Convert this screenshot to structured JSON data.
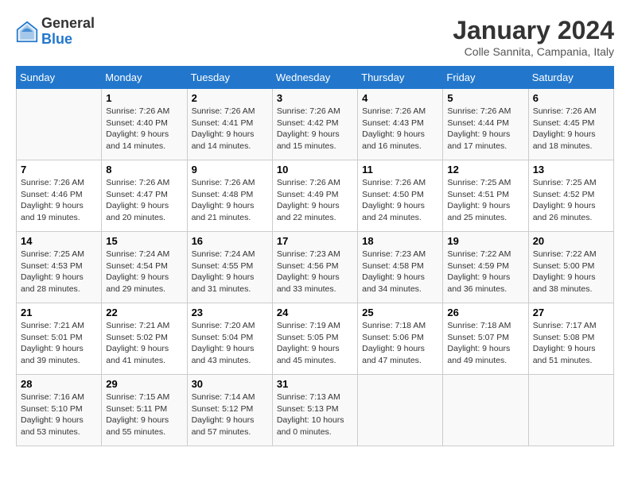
{
  "header": {
    "logo_general": "General",
    "logo_blue": "Blue",
    "title": "January 2024",
    "location": "Colle Sannita, Campania, Italy"
  },
  "days_of_week": [
    "Sunday",
    "Monday",
    "Tuesday",
    "Wednesday",
    "Thursday",
    "Friday",
    "Saturday"
  ],
  "weeks": [
    [
      {
        "num": "",
        "info": ""
      },
      {
        "num": "1",
        "info": "Sunrise: 7:26 AM\nSunset: 4:40 PM\nDaylight: 9 hours\nand 14 minutes."
      },
      {
        "num": "2",
        "info": "Sunrise: 7:26 AM\nSunset: 4:41 PM\nDaylight: 9 hours\nand 14 minutes."
      },
      {
        "num": "3",
        "info": "Sunrise: 7:26 AM\nSunset: 4:42 PM\nDaylight: 9 hours\nand 15 minutes."
      },
      {
        "num": "4",
        "info": "Sunrise: 7:26 AM\nSunset: 4:43 PM\nDaylight: 9 hours\nand 16 minutes."
      },
      {
        "num": "5",
        "info": "Sunrise: 7:26 AM\nSunset: 4:44 PM\nDaylight: 9 hours\nand 17 minutes."
      },
      {
        "num": "6",
        "info": "Sunrise: 7:26 AM\nSunset: 4:45 PM\nDaylight: 9 hours\nand 18 minutes."
      }
    ],
    [
      {
        "num": "7",
        "info": "Sunrise: 7:26 AM\nSunset: 4:46 PM\nDaylight: 9 hours\nand 19 minutes."
      },
      {
        "num": "8",
        "info": "Sunrise: 7:26 AM\nSunset: 4:47 PM\nDaylight: 9 hours\nand 20 minutes."
      },
      {
        "num": "9",
        "info": "Sunrise: 7:26 AM\nSunset: 4:48 PM\nDaylight: 9 hours\nand 21 minutes."
      },
      {
        "num": "10",
        "info": "Sunrise: 7:26 AM\nSunset: 4:49 PM\nDaylight: 9 hours\nand 22 minutes."
      },
      {
        "num": "11",
        "info": "Sunrise: 7:26 AM\nSunset: 4:50 PM\nDaylight: 9 hours\nand 24 minutes."
      },
      {
        "num": "12",
        "info": "Sunrise: 7:25 AM\nSunset: 4:51 PM\nDaylight: 9 hours\nand 25 minutes."
      },
      {
        "num": "13",
        "info": "Sunrise: 7:25 AM\nSunset: 4:52 PM\nDaylight: 9 hours\nand 26 minutes."
      }
    ],
    [
      {
        "num": "14",
        "info": "Sunrise: 7:25 AM\nSunset: 4:53 PM\nDaylight: 9 hours\nand 28 minutes."
      },
      {
        "num": "15",
        "info": "Sunrise: 7:24 AM\nSunset: 4:54 PM\nDaylight: 9 hours\nand 29 minutes."
      },
      {
        "num": "16",
        "info": "Sunrise: 7:24 AM\nSunset: 4:55 PM\nDaylight: 9 hours\nand 31 minutes."
      },
      {
        "num": "17",
        "info": "Sunrise: 7:23 AM\nSunset: 4:56 PM\nDaylight: 9 hours\nand 33 minutes."
      },
      {
        "num": "18",
        "info": "Sunrise: 7:23 AM\nSunset: 4:58 PM\nDaylight: 9 hours\nand 34 minutes."
      },
      {
        "num": "19",
        "info": "Sunrise: 7:22 AM\nSunset: 4:59 PM\nDaylight: 9 hours\nand 36 minutes."
      },
      {
        "num": "20",
        "info": "Sunrise: 7:22 AM\nSunset: 5:00 PM\nDaylight: 9 hours\nand 38 minutes."
      }
    ],
    [
      {
        "num": "21",
        "info": "Sunrise: 7:21 AM\nSunset: 5:01 PM\nDaylight: 9 hours\nand 39 minutes."
      },
      {
        "num": "22",
        "info": "Sunrise: 7:21 AM\nSunset: 5:02 PM\nDaylight: 9 hours\nand 41 minutes."
      },
      {
        "num": "23",
        "info": "Sunrise: 7:20 AM\nSunset: 5:04 PM\nDaylight: 9 hours\nand 43 minutes."
      },
      {
        "num": "24",
        "info": "Sunrise: 7:19 AM\nSunset: 5:05 PM\nDaylight: 9 hours\nand 45 minutes."
      },
      {
        "num": "25",
        "info": "Sunrise: 7:18 AM\nSunset: 5:06 PM\nDaylight: 9 hours\nand 47 minutes."
      },
      {
        "num": "26",
        "info": "Sunrise: 7:18 AM\nSunset: 5:07 PM\nDaylight: 9 hours\nand 49 minutes."
      },
      {
        "num": "27",
        "info": "Sunrise: 7:17 AM\nSunset: 5:08 PM\nDaylight: 9 hours\nand 51 minutes."
      }
    ],
    [
      {
        "num": "28",
        "info": "Sunrise: 7:16 AM\nSunset: 5:10 PM\nDaylight: 9 hours\nand 53 minutes."
      },
      {
        "num": "29",
        "info": "Sunrise: 7:15 AM\nSunset: 5:11 PM\nDaylight: 9 hours\nand 55 minutes."
      },
      {
        "num": "30",
        "info": "Sunrise: 7:14 AM\nSunset: 5:12 PM\nDaylight: 9 hours\nand 57 minutes."
      },
      {
        "num": "31",
        "info": "Sunrise: 7:13 AM\nSunset: 5:13 PM\nDaylight: 10 hours\nand 0 minutes."
      },
      {
        "num": "",
        "info": ""
      },
      {
        "num": "",
        "info": ""
      },
      {
        "num": "",
        "info": ""
      }
    ]
  ]
}
